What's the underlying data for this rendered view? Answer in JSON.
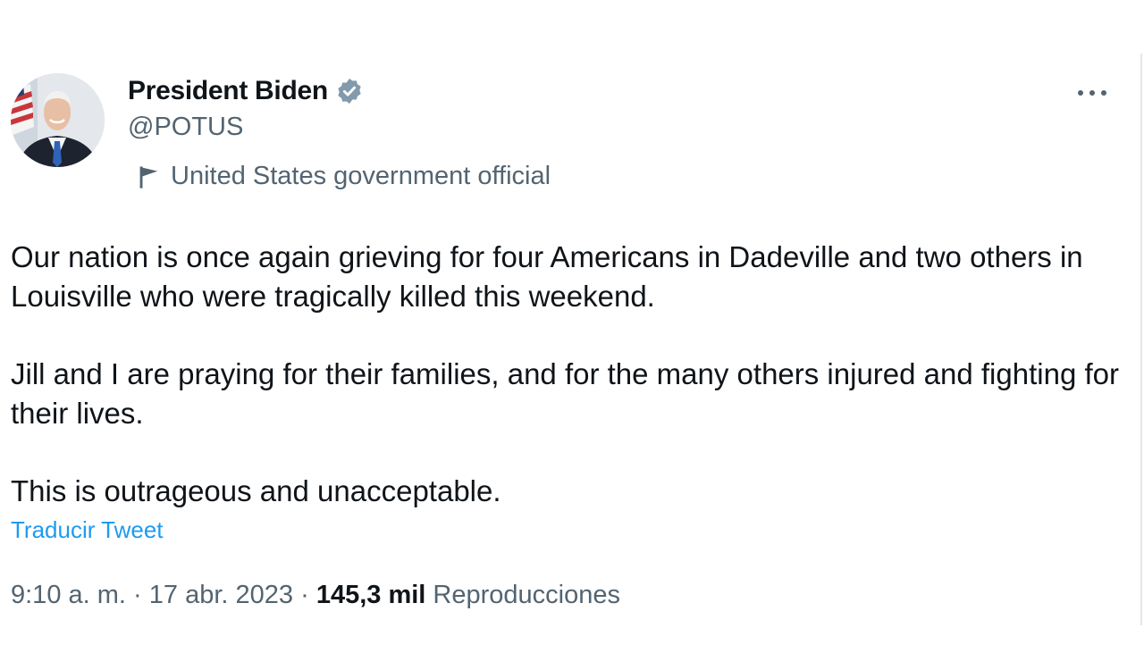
{
  "author": {
    "display_name": "President Biden",
    "handle": "@POTUS",
    "label": "United States government official"
  },
  "tweet": {
    "paragraphs": [
      "Our nation is once again grieving for four Americans in Dadeville and two others in Louisville who were tragically killed this weekend.",
      "Jill and I are praying for their families, and for the many others injured and fighting for their lives.",
      "This is outrageous and unacceptable."
    ],
    "translate_link": "Traducir Tweet"
  },
  "meta": {
    "time": "9:10 a. m.",
    "separator": "·",
    "date": "17 abr. 2023",
    "views_count": "145,3 mil",
    "views_label": "Reproducciones"
  },
  "icons": {
    "verified": "verified-badge-icon",
    "label_flag": "flag-icon",
    "more": "more-options-icon"
  },
  "colors": {
    "text": "#0f1419",
    "secondary": "#536471",
    "link": "#1d9bf0",
    "verified_badge": "#829aab"
  }
}
